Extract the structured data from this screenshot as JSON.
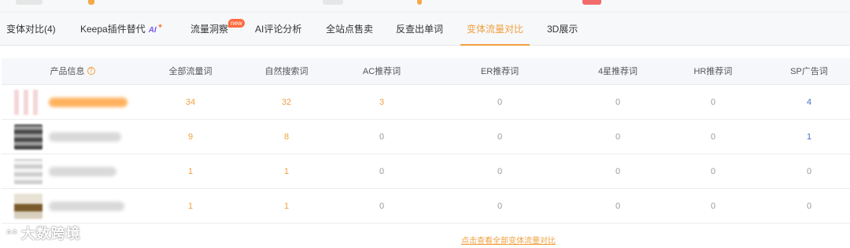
{
  "tabs": [
    {
      "label": "变体对比(4)",
      "active": false
    },
    {
      "label": "Keepa插件替代",
      "ai_tag": "AI",
      "active": false
    },
    {
      "label": "流量洞察",
      "badge": "new",
      "active": false
    },
    {
      "label": "AI评论分析",
      "active": false
    },
    {
      "label": "全站点售卖",
      "active": false
    },
    {
      "label": "反查出单词",
      "active": false
    },
    {
      "label": "变体流量对比",
      "active": true
    },
    {
      "label": "3D展示",
      "active": false
    }
  ],
  "table": {
    "headers": [
      "产品信息",
      "全部流量词",
      "自然搜索词",
      "AC推荐词",
      "ER推荐词",
      "4星推荐词",
      "HR推荐词",
      "SP广告词"
    ],
    "rows": [
      {
        "values": [
          "34",
          "32",
          "3",
          "0",
          "0",
          "0",
          "4"
        ]
      },
      {
        "values": [
          "9",
          "8",
          "0",
          "0",
          "0",
          "0",
          "1"
        ]
      },
      {
        "values": [
          "1",
          "1",
          "0",
          "0",
          "0",
          "0",
          "0"
        ]
      },
      {
        "values": [
          "1",
          "1",
          "0",
          "0",
          "0",
          "0",
          "0"
        ]
      }
    ]
  },
  "footer": {
    "view_all_label": "点击查看全部变体流量对比"
  },
  "watermark": {
    "text": "大数跨境"
  },
  "colors": {
    "accent": "#f0a040",
    "blue": "#4a6fd0",
    "muted": "#999999"
  },
  "icons": {
    "help": "question-circle-icon",
    "product_thumbnail": "image-thumbnail"
  }
}
